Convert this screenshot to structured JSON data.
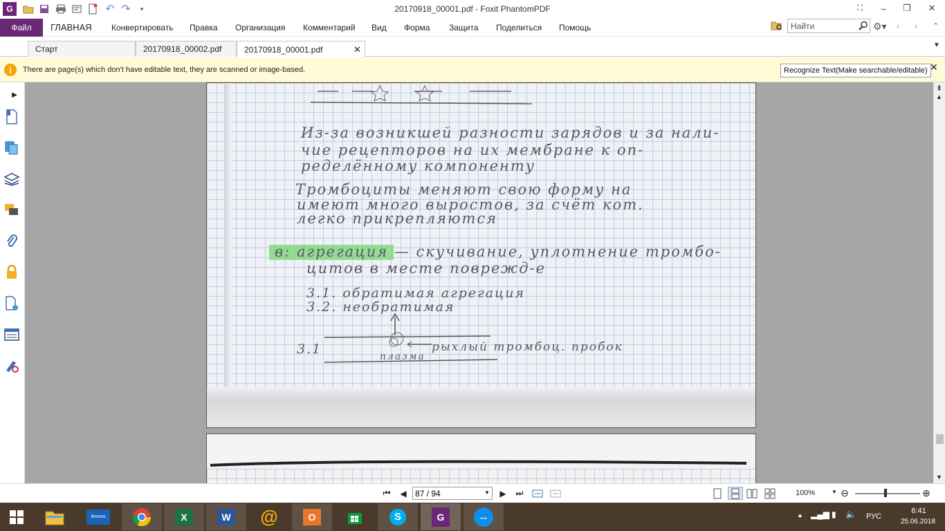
{
  "window": {
    "title": "20170918_00001.pdf - Foxit PhantomPDF"
  },
  "ribbon": {
    "file_label": "Файл",
    "tabs": [
      "ГЛАВНАЯ",
      "Конвертировать",
      "Правка",
      "Организация",
      "Комментарий",
      "Вид",
      "Форма",
      "Защита",
      "Поделиться",
      "Помощь"
    ],
    "search_placeholder": "Найти"
  },
  "doc_tabs": [
    {
      "label": "Старт"
    },
    {
      "label": "20170918_00002.pdf"
    },
    {
      "label": "20170918_00001.pdf"
    }
  ],
  "notification": {
    "text": "There are page(s) which don't have editable text, they are scanned or image-based.",
    "button_label": "Recognize Text(Make searchable/editable)"
  },
  "handwriting": {
    "line1": "Из-за возникшей разности зарядов и за нали-",
    "line2": "чие рецепторов на их мембране к оп-",
    "line3": "ределённому компоненту",
    "line4": "Тромбоциты меняют свою форму на",
    "line5": "имеют много выростов, за счёт кот.",
    "line6": "легко прикрепляются",
    "line7": "в: агрегация — скучивание, уплотнение тромбо-",
    "line8": "цитов в месте поврежд-е",
    "line9": "3.1. обратимая агрегация",
    "line10": "3.2. необратимая",
    "line11": "рыхлый тромбоц. пробок",
    "line12": "плазма",
    "label_31": "3.1"
  },
  "status": {
    "page_value": "87 / 94",
    "zoom": "100%"
  },
  "taskbar": {
    "language": "РУС",
    "time": "6:41",
    "date": "25.06.2018",
    "apps": [
      "explorer",
      "lenovo",
      "chrome",
      "excel",
      "word",
      "mail",
      "outlook",
      "store",
      "skype",
      "foxit",
      "teamviewer"
    ]
  },
  "colors": {
    "accent": "#6a2776",
    "notification_bg": "#fffad8",
    "doc_bg": "#a6a6a6",
    "taskbar_bg": "#4a3a2c",
    "highlight": "#7fd67a"
  }
}
